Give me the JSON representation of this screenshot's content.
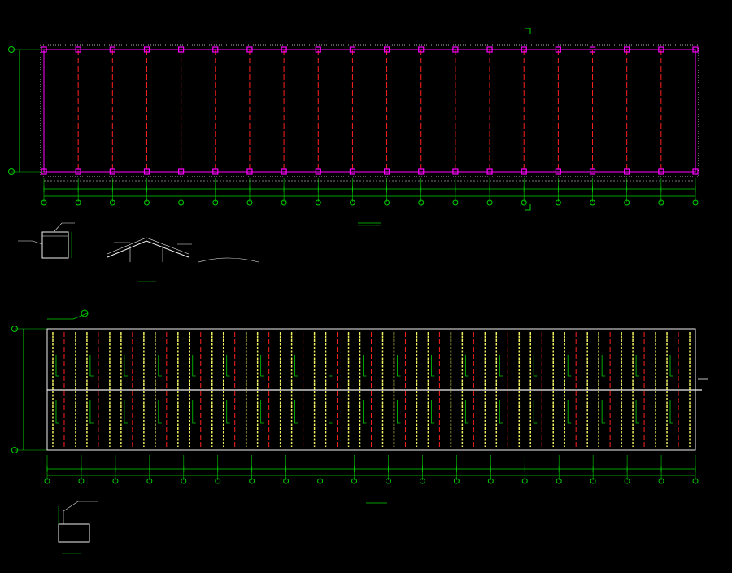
{
  "title": "",
  "colors": {
    "background": "#000000",
    "axis_green": "#00d000",
    "column_magenta": "#ff00ff",
    "dash_red": "#ff2020",
    "outline_white": "#f0f0f0",
    "purlin_yellow": "#f0f060",
    "label_white": "#e8e8e8"
  },
  "top_plan": {
    "bays": 19,
    "label": "",
    "scale": ""
  },
  "bottom_plan": {
    "bays": 19,
    "label": "",
    "scale": ""
  }
}
